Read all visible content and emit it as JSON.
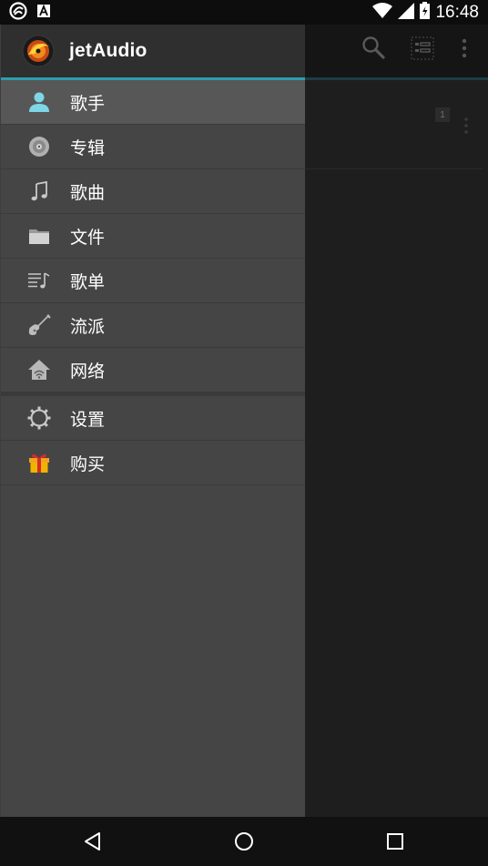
{
  "status_bar": {
    "time": "16:48",
    "left_icons": [
      "app-notification-icon",
      "a-notification-icon"
    ],
    "right_icons": [
      "wifi-icon",
      "signal-icon",
      "battery-icon"
    ]
  },
  "background": {
    "toolbar_icons": [
      "search-icon",
      "view-toggle-icon",
      "overflow-menu-icon"
    ],
    "row_badge": "1"
  },
  "drawer": {
    "app_title": "jetAudio",
    "accent_color": "#2b9fad",
    "items": [
      {
        "label": "歌手",
        "icon": "artist-icon",
        "selected": true
      },
      {
        "label": "专辑",
        "icon": "album-icon",
        "selected": false
      },
      {
        "label": "歌曲",
        "icon": "music-note-icon",
        "selected": false
      },
      {
        "label": "文件",
        "icon": "folder-icon",
        "selected": false
      },
      {
        "label": "歌单",
        "icon": "playlist-icon",
        "selected": false
      },
      {
        "label": "流派",
        "icon": "guitar-icon",
        "selected": false
      },
      {
        "label": "网络",
        "icon": "network-icon",
        "selected": false
      }
    ],
    "secondary_items": [
      {
        "label": "设置",
        "icon": "gear-icon"
      },
      {
        "label": "购买",
        "icon": "gift-icon"
      }
    ]
  },
  "nav_bar": {
    "buttons": [
      "back-icon",
      "home-icon",
      "recents-icon"
    ]
  }
}
